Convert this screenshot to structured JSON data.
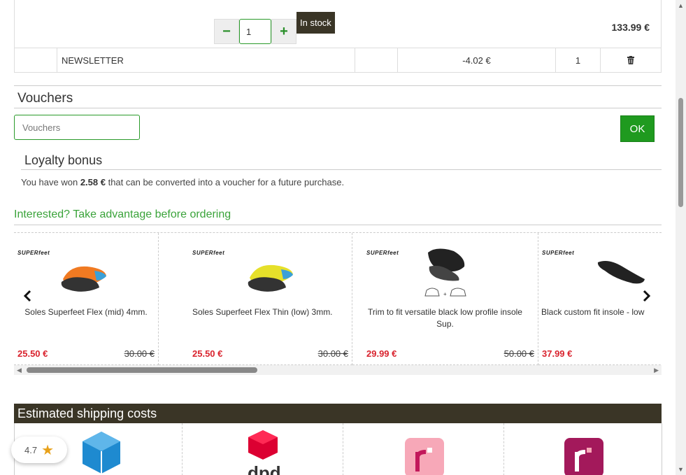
{
  "cart": {
    "quantity": "1",
    "minus": "−",
    "plus": "+",
    "stock_label": "In stock",
    "line_price": "133.99 €",
    "newsletter": {
      "name": "NEWSLETTER",
      "amount": "-4.02 €",
      "qty": "1",
      "delete_icon": "trash-icon"
    }
  },
  "vouchers": {
    "title": "Vouchers",
    "placeholder": "Vouchers",
    "ok_label": "OK"
  },
  "loyalty": {
    "title": "Loyalty bonus",
    "text_before": "You have won ",
    "amount": "2.58 €",
    "text_after": " that can be converted into a voucher for a future purchase."
  },
  "upsell": {
    "heading": "Interested? Take advantage before ordering",
    "products": [
      {
        "brand": "SUPERfeet",
        "name": "Soles Superfeet Flex (mid) 4mm.",
        "price": "25.50 €",
        "old_price": "30.00 €",
        "color": "orange"
      },
      {
        "brand": "SUPERfeet",
        "name": "Soles Superfeet Flex Thin (low) 3mm.",
        "price": "25.50 €",
        "old_price": "30.00 €",
        "color": "yellow"
      },
      {
        "brand": "SUPERfeet",
        "name": "Trim to fit versatile black low profile insole Sup.",
        "price": "29.99 €",
        "old_price": "50.00 €",
        "color": "black"
      },
      {
        "brand": "SUPERfeet",
        "name": "Black custom fit insole - low",
        "price": "37.99 €",
        "old_price": "",
        "color": "black"
      }
    ],
    "prev_icon": "chevron-left-icon",
    "next_icon": "chevron-right-icon"
  },
  "shipping": {
    "title": "Estimated shipping costs",
    "carriers": [
      "box-logo",
      "dpd-logo",
      "relay-logo-pink",
      "relay-logo-magenta"
    ],
    "dpd_text": "dpd"
  },
  "rating": {
    "value": "4.7",
    "icon": "star-icon"
  },
  "colors": {
    "accent_green": "#2a9a2a",
    "dark_bar": "#3a3526",
    "sale_red": "#d9232e"
  }
}
